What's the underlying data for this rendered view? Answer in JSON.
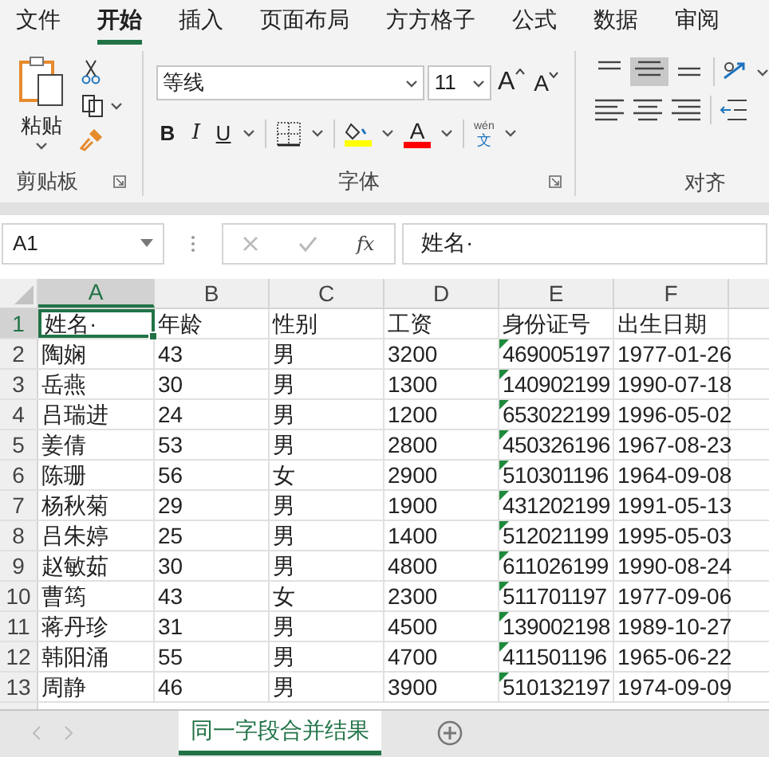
{
  "ribbon_tabs": [
    {
      "label": "文件",
      "selected": false
    },
    {
      "label": "开始",
      "selected": true
    },
    {
      "label": "插入",
      "selected": false
    },
    {
      "label": "页面布局",
      "selected": false
    },
    {
      "label": "方方格子",
      "selected": false
    },
    {
      "label": "公式",
      "selected": false
    },
    {
      "label": "数据",
      "selected": false
    },
    {
      "label": "审阅",
      "selected": false
    }
  ],
  "ribbon": {
    "clipboard": {
      "paste_label": "粘贴",
      "group_label": "剪贴板"
    },
    "font": {
      "font_name": "等线",
      "font_size": "11",
      "grow_label": "A",
      "shrink_label": "A",
      "bold": "B",
      "italic": "I",
      "underline": "U",
      "font_color_letter": "A",
      "phonetic_top": "wén",
      "phonetic_bottom": "文",
      "group_label": "字体"
    },
    "alignment": {
      "group_label": "对齐"
    }
  },
  "formula_bar": {
    "name_box": "A1",
    "fx": "fx",
    "value": "姓名·"
  },
  "sheet": {
    "columns": [
      {
        "label": "A",
        "selected": true
      },
      {
        "label": "B",
        "selected": false
      },
      {
        "label": "C",
        "selected": false
      },
      {
        "label": "D",
        "selected": false
      },
      {
        "label": "E",
        "selected": false
      },
      {
        "label": "F",
        "selected": false
      }
    ],
    "rows": [
      {
        "number": "1",
        "selected": true,
        "flagged": false,
        "cells": [
          "姓名·",
          "年龄",
          "性别",
          "工资",
          "身份证号",
          "出生日期"
        ]
      },
      {
        "number": "2",
        "selected": false,
        "flagged": true,
        "cells": [
          "陶娴",
          "43",
          "男",
          "3200",
          "469005197",
          "1977-01-26"
        ]
      },
      {
        "number": "3",
        "selected": false,
        "flagged": true,
        "cells": [
          "岳燕",
          "30",
          "男",
          "1300",
          "140902199",
          "1990-07-18"
        ]
      },
      {
        "number": "4",
        "selected": false,
        "flagged": true,
        "cells": [
          "吕瑞进",
          "24",
          "男",
          "1200",
          "653022199",
          "1996-05-02"
        ]
      },
      {
        "number": "5",
        "selected": false,
        "flagged": true,
        "cells": [
          "姜倩",
          "53",
          "男",
          "2800",
          "450326196",
          "1967-08-23"
        ]
      },
      {
        "number": "6",
        "selected": false,
        "flagged": true,
        "cells": [
          "陈珊",
          "56",
          "女",
          "2900",
          "510301196",
          "1964-09-08"
        ]
      },
      {
        "number": "7",
        "selected": false,
        "flagged": true,
        "cells": [
          "杨秋菊",
          "29",
          "男",
          "1900",
          "431202199",
          "1991-05-13"
        ]
      },
      {
        "number": "8",
        "selected": false,
        "flagged": true,
        "cells": [
          "吕朱婷",
          "25",
          "男",
          "1400",
          "512021199",
          "1995-05-03"
        ]
      },
      {
        "number": "9",
        "selected": false,
        "flagged": true,
        "cells": [
          "赵敏茹",
          "30",
          "男",
          "4800",
          "611026199",
          "1990-08-24"
        ]
      },
      {
        "number": "10",
        "selected": false,
        "flagged": true,
        "cells": [
          "曹筠",
          "43",
          "女",
          "2300",
          "511701197",
          "1977-09-06"
        ]
      },
      {
        "number": "11",
        "selected": false,
        "flagged": true,
        "cells": [
          "蒋丹珍",
          "31",
          "男",
          "4500",
          "139002198",
          "1989-10-27"
        ]
      },
      {
        "number": "12",
        "selected": false,
        "flagged": true,
        "cells": [
          "韩阳涌",
          "55",
          "男",
          "4700",
          "411501196",
          "1965-06-22"
        ]
      },
      {
        "number": "13",
        "selected": false,
        "flagged": true,
        "cells": [
          "周静",
          "46",
          "男",
          "3900",
          "510132197",
          "1974-09-09"
        ]
      }
    ]
  },
  "sheet_tabs": [
    {
      "label": "同一字段合并结果",
      "selected": true
    }
  ]
}
